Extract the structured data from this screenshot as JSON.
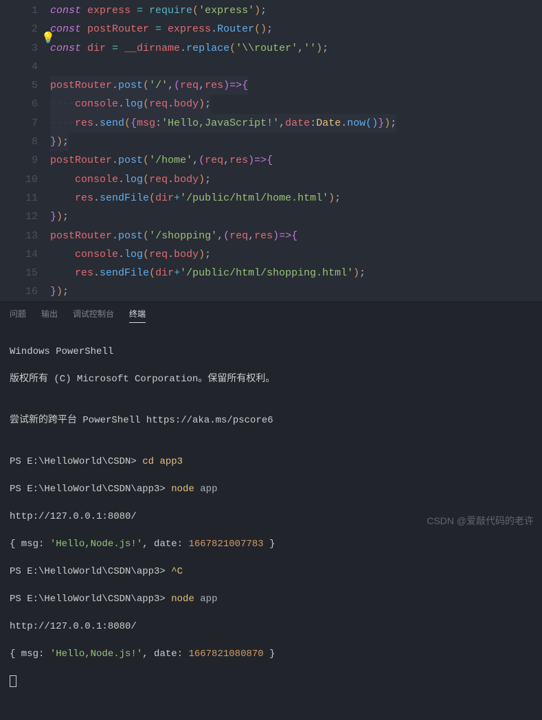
{
  "editor": {
    "lines": [
      "1",
      "2",
      "3",
      "4",
      "5",
      "6",
      "7",
      "8",
      "9",
      "10",
      "11",
      "12",
      "13",
      "14",
      "15",
      "16"
    ],
    "code": {
      "l1_const": "const ",
      "l1_express": "express",
      "l1_eq": " = ",
      "l1_require": "require",
      "l1_p1": "(",
      "l1_str": "'express'",
      "l1_p2": ")",
      "l1_semi": ";",
      "l2_const": "const ",
      "l2_pr": "postRouter",
      "l2_eq": " = ",
      "l2_express": "express",
      "l2_dot": ".",
      "l2_router": "Router",
      "l2_p1": "()",
      "l2_semi": ";",
      "l3_const": "const ",
      "l3_dir": "dir",
      "l3_eq": " = ",
      "l3_dirname": "__dirname",
      "l3_dot": ".",
      "l3_replace": "replace",
      "l3_p1": "(",
      "l3_s1": "'\\\\router'",
      "l3_c": ",",
      "l3_s2": "''",
      "l3_p2": ")",
      "l3_semi": ";",
      "l5_pr": "postRouter",
      "l5_dot": ".",
      "l5_post": "post",
      "l5_p1": "(",
      "l5_s": "'/'",
      "l5_c": ",",
      "l5_p2": "(",
      "l5_req": "req",
      "l5_c2": ",",
      "l5_res": "res",
      "l5_p3": ")",
      "l5_arrow": "=>",
      "l5_p4": "{",
      "l6_dots": "····",
      "l6_console": "console",
      "l6_dot": ".",
      "l6_log": "log",
      "l6_p1": "(",
      "l6_req": "req",
      "l6_dot2": ".",
      "l6_body": "body",
      "l6_p2": ")",
      "l6_semi": ";",
      "l7_dots": "····",
      "l7_res": "res",
      "l7_dot": ".",
      "l7_send": "send",
      "l7_p1": "(",
      "l7_p2": "{",
      "l7_msg": "msg",
      "l7_col": ":",
      "l7_s": "'Hello,JavaScript!'",
      "l7_c": ",",
      "l7_date": "date",
      "l7_col2": ":",
      "l7_Date": "Date",
      "l7_dot2": ".",
      "l7_now": "now",
      "l7_p3": "()",
      "l7_p4": "}",
      "l7_p5": ")",
      "l7_semi": ";",
      "l8_p": "}",
      "l8_p2": ")",
      "l8_semi": ";",
      "l9_pr": "postRouter",
      "l9_dot": ".",
      "l9_post": "post",
      "l9_p1": "(",
      "l9_s": "'/home'",
      "l9_c": ",",
      "l9_p2": "(",
      "l9_req": "req",
      "l9_c2": ",",
      "l9_res": "res",
      "l9_p3": ")",
      "l9_arrow": "=>",
      "l9_p4": "{",
      "l10_sp": "    ",
      "l10_console": "console",
      "l10_dot": ".",
      "l10_log": "log",
      "l10_p1": "(",
      "l10_req": "req",
      "l10_dot2": ".",
      "l10_body": "body",
      "l10_p2": ")",
      "l10_semi": ";",
      "l11_sp": "    ",
      "l11_res": "res",
      "l11_dot": ".",
      "l11_sf": "sendFile",
      "l11_p1": "(",
      "l11_dir": "dir",
      "l11_plus": "+",
      "l11_s": "'/public/html/home.html'",
      "l11_p2": ")",
      "l11_semi": ";",
      "l12_p": "}",
      "l12_p2": ")",
      "l12_semi": ";",
      "l13_pr": "postRouter",
      "l13_dot": ".",
      "l13_post": "post",
      "l13_p1": "(",
      "l13_s": "'/shopping'",
      "l13_c": ",",
      "l13_p2": "(",
      "l13_req": "req",
      "l13_c2": ",",
      "l13_res": "res",
      "l13_p3": ")",
      "l13_arrow": "=>",
      "l13_p4": "{",
      "l14_sp": "    ",
      "l14_console": "console",
      "l14_dot": ".",
      "l14_log": "log",
      "l14_p1": "(",
      "l14_req": "req",
      "l14_dot2": ".",
      "l14_body": "body",
      "l14_p2": ")",
      "l14_semi": ";",
      "l15_sp": "    ",
      "l15_res": "res",
      "l15_dot": ".",
      "l15_sf": "sendFile",
      "l15_p1": "(",
      "l15_dir": "dir",
      "l15_plus": "+",
      "l15_s": "'/public/html/shopping.html'",
      "l15_p2": ")",
      "l15_semi": ";",
      "l16_p": "}",
      "l16_p2": ")",
      "l16_semi": ";"
    }
  },
  "tabs": {
    "problems": "问题",
    "output": "输出",
    "debug": "调试控制台",
    "terminal": "终端"
  },
  "terminal": {
    "l1": "Windows PowerShell",
    "l2": "版权所有 (C) Microsoft Corporation。保留所有权利。",
    "l3": "",
    "l4": "尝试新的跨平台 PowerShell https://aka.ms/pscore6",
    "l5": "",
    "l6a": "PS E:\\HelloWorld\\CSDN> ",
    "l6b": "cd app3",
    "l7a": "PS E:\\HelloWorld\\CSDN\\app3> ",
    "l7b": "node ",
    "l7c": "app",
    "l8": "http://127.0.0.1:8080/",
    "l9a": "{ msg: ",
    "l9b": "'Hello,Node.js!'",
    "l9c": ", date: ",
    "l9d": "1667821007783",
    "l9e": " }",
    "l10a": "PS E:\\HelloWorld\\CSDN\\app3> ",
    "l10b": "^C",
    "l11a": "PS E:\\HelloWorld\\CSDN\\app3> ",
    "l11b": "node ",
    "l11c": "app",
    "l12": "http://127.0.0.1:8080/",
    "l13a": "{ msg: ",
    "l13b": "'Hello,Node.js!'",
    "l13c": ", date: ",
    "l13d": "1667821080870",
    "l13e": " }"
  },
  "watermark": "CSDN @爱敲代码的老许"
}
